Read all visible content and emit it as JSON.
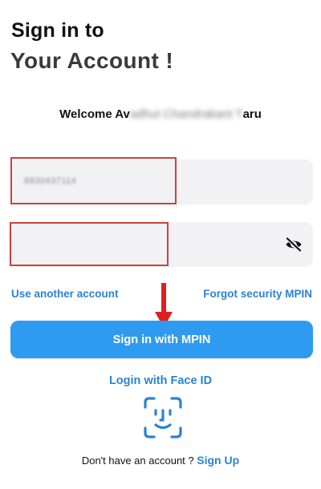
{
  "header": {
    "title_line1": "Sign in to",
    "title_line2": "Your Account !"
  },
  "welcome": {
    "prefix": "Welcome Av",
    "blurred_name": "adhut Chandrakant T",
    "suffix": "aru"
  },
  "form": {
    "mobile_value": "8830437114",
    "mpin_value": "",
    "mpin_placeholder": "",
    "toggle_icon": "eye-off-icon"
  },
  "links": {
    "use_another_account": "Use another account",
    "forgot_mpin": "Forgot security MPIN"
  },
  "primary_button": {
    "label": "Sign in with MPIN"
  },
  "face_id": {
    "label": "Login with Face ID",
    "icon": "face-id-icon"
  },
  "signup": {
    "prompt": "Don't have an account ?",
    "link": "Sign Up"
  },
  "colors": {
    "accent": "#2f9bf0",
    "link": "#2a83d4",
    "highlight": "#cf3f3f",
    "arrow": "#e0201f",
    "field_bg": "#f2f2f4"
  }
}
